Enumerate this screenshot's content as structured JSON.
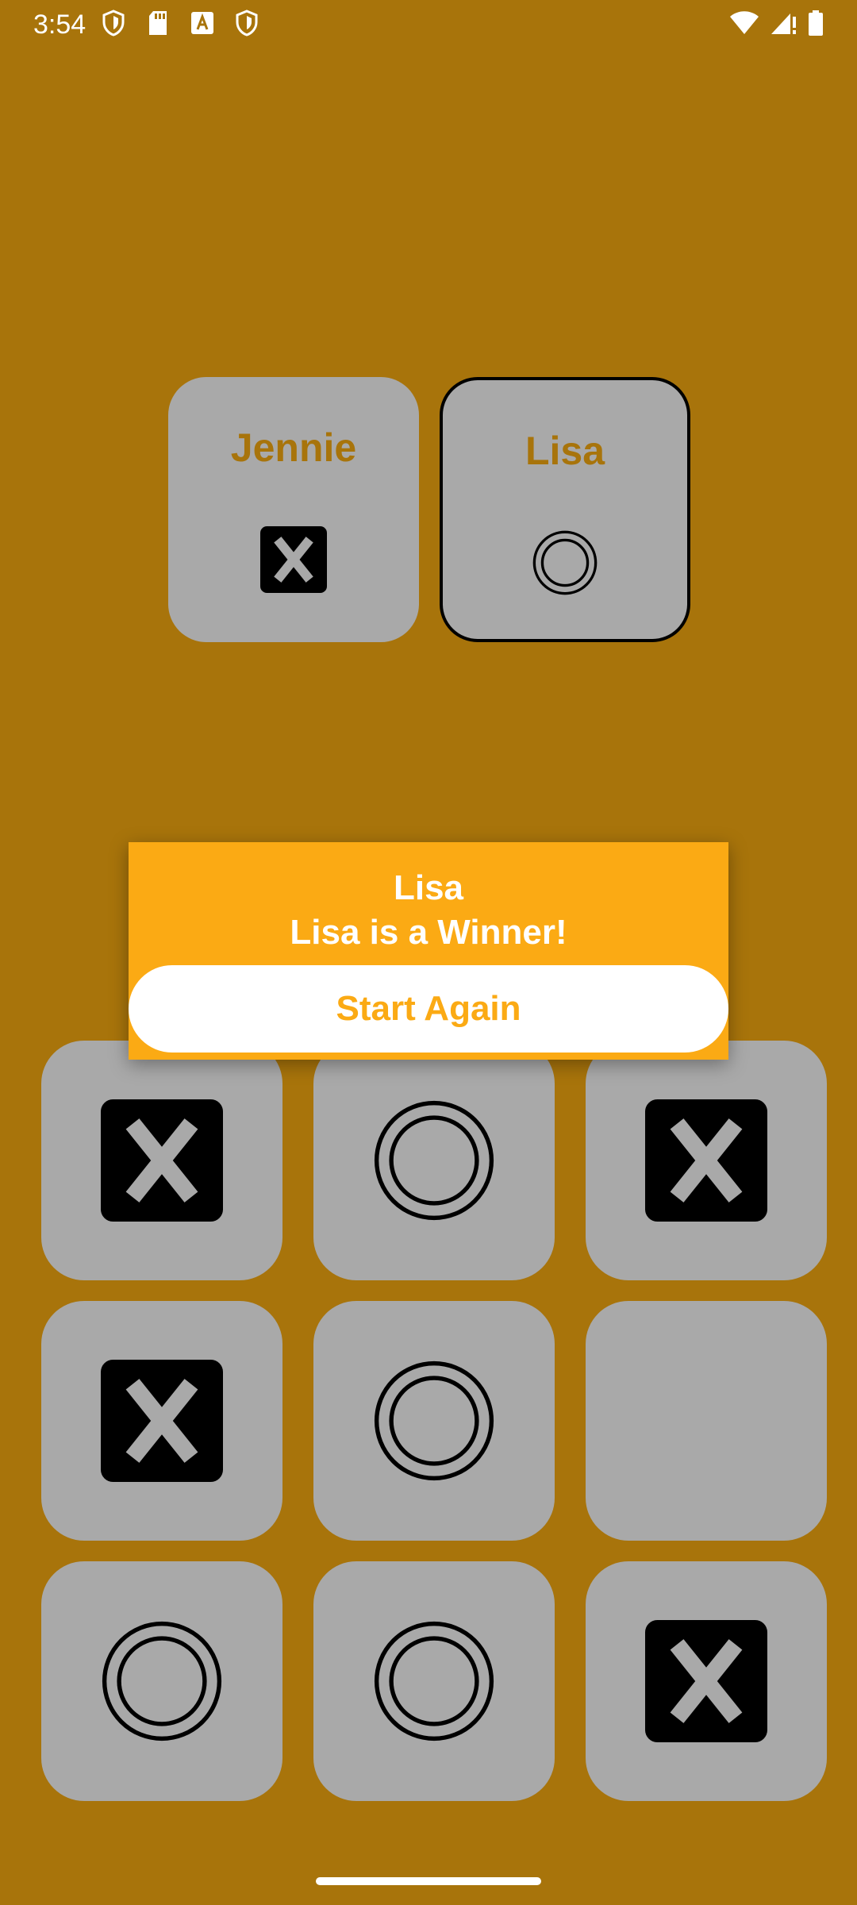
{
  "status_bar": {
    "time": "3:54",
    "left_icons": [
      "shield-icon",
      "sd-card-icon",
      "font-a-icon",
      "shield-icon"
    ],
    "right_icons": [
      "wifi-icon",
      "signal-icon",
      "battery-icon"
    ]
  },
  "players": [
    {
      "name": "Jennie",
      "mark": "x",
      "active": false
    },
    {
      "name": "Lisa",
      "mark": "o",
      "active": true
    }
  ],
  "board": [
    "x",
    "o",
    "x",
    "x",
    "o",
    "",
    "o",
    "o",
    "x"
  ],
  "dialog": {
    "player_name": "Lisa",
    "message": "Lisa is a Winner!",
    "button_label": "Start Again"
  },
  "colors": {
    "background": "#A8740B",
    "card": "#A9A9A9",
    "dialog": "#FBAA14"
  }
}
